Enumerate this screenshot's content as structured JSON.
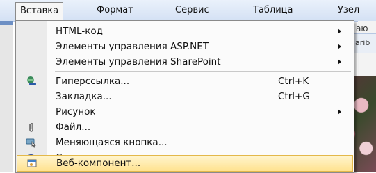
{
  "menubar": {
    "items": [
      {
        "label": "Вставка"
      },
      {
        "label": "Формат"
      },
      {
        "label": "Сервис"
      },
      {
        "label": "Таблица"
      },
      {
        "label": "Узел"
      }
    ]
  },
  "background": {
    "doc_text_1": "аю",
    "doc_text_2": "arib"
  },
  "menu": {
    "items": [
      {
        "label": "HTML-код",
        "has_submenu": true
      },
      {
        "label": "Элементы управления ASP.NET",
        "has_submenu": true
      },
      {
        "label": "Элементы управления SharePoint",
        "has_submenu": true
      },
      {
        "label": "Гиперссылка...",
        "shortcut": "Ctrl+K",
        "icon": "hyperlink-icon"
      },
      {
        "label": "Закладка...",
        "shortcut": "Ctrl+G"
      },
      {
        "label": "Рисунок",
        "has_submenu": true
      },
      {
        "label": "Файл...",
        "icon": "paperclip-icon"
      },
      {
        "label": "Меняющаяся кнопка...",
        "icon": "interactive-button-icon"
      },
      {
        "label": "Символ...",
        "icon": "omega-icon"
      },
      {
        "label": "Веб-компонент...",
        "icon": "web-component-icon",
        "selected": true
      }
    ]
  },
  "colors": {
    "highlight_fill": "#ffe28f",
    "highlight_border": "#e3b84a",
    "menubar": "#d4e1f4"
  }
}
